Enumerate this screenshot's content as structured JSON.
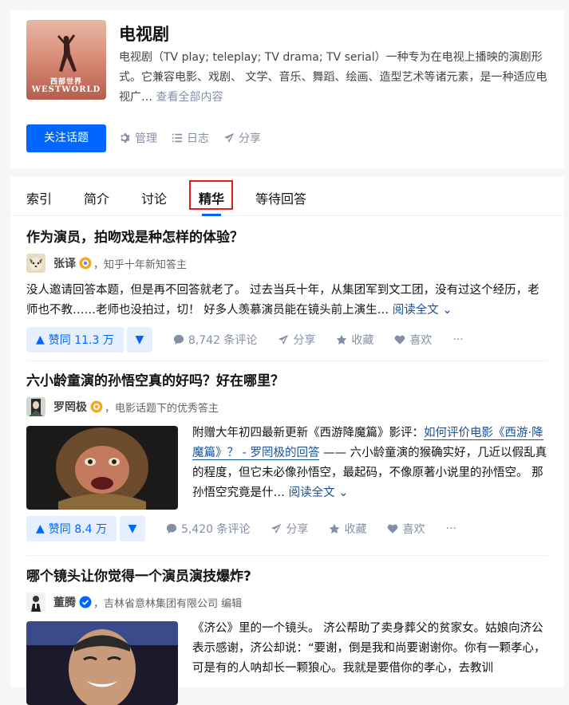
{
  "topic": {
    "cover_cn": "西部世界",
    "cover_en": "WESTWORLD",
    "title": "电视剧",
    "description": "电视剧（TV play; teleplay; TV drama; TV serial）一种专为在电视上播映的演剧形式。它兼容电影、戏剧、 文学、音乐、舞蹈、绘画、造型艺术等诸元素，是一种适应电视广…",
    "view_all": "查看全部内容",
    "follow_label": "关注话题",
    "actions": [
      {
        "icon": "gear-icon",
        "label": "管理"
      },
      {
        "icon": "list-icon",
        "label": "日志"
      },
      {
        "icon": "share-icon",
        "label": "分享"
      }
    ]
  },
  "tabs": [
    "索引",
    "简介",
    "讨论",
    "精华",
    "等待回答"
  ],
  "active_tab": "精华",
  "colors": {
    "accent": "#0066ff",
    "highlight_box": "#e0201e",
    "link": "#175199"
  },
  "items": [
    {
      "title": "作为演员，拍吻戏是种怎样的体验？",
      "author": "张译",
      "badge": "gold-badge-icon",
      "bio": "，知乎十年新知答主",
      "excerpt": "没人邀请回答本题，但是再不回答就老了。 过去当兵十年，从集团军到文工团，没有过这个经历，老师也不教……老师也没拍过，切！ 好多人羡慕演员能在镜头前上演生…",
      "read_more": "阅读全文",
      "votes": "赞同 11.3 万",
      "comments": "8,742 条评论",
      "share": "分享",
      "collect": "收藏",
      "like": "喜欢",
      "more": "···"
    },
    {
      "title": "六小龄童演的孙悟空真的好吗？好在哪里？",
      "author": "罗罔极",
      "badge": "gold-badge-icon",
      "bio": "，电影话题下的优秀答主",
      "excerpt_pre": "附赠大年初四最新更新《西游降魔篇》影评：",
      "excerpt_link": "如何评价电影《西游·降魔篇》？ - 罗罔极的回答",
      "excerpt_post": " —— 六小龄童演的猴确实好，几近以假乱真的程度，但它未必像孙悟空，最起码，不像原著小说里的孙悟空。 那孙悟空究竟是什…",
      "read_more": "阅读全文",
      "votes": "赞同 8.4 万",
      "comments": "5,420 条评论",
      "share": "分享",
      "collect": "收藏",
      "like": "喜欢",
      "more": "···"
    },
    {
      "title": "哪个镜头让你觉得一个演员演技爆炸?",
      "author": "董腾",
      "badge": "blue-verified-icon",
      "bio": "，吉林省意林集团有限公司 编辑",
      "excerpt": "《济公》里的一个镜头。 济公帮助了卖身葬父的贫家女。姑娘向济公表示感谢，济公却说：“要谢，倒是我和尚要谢谢你。你有一颗孝心，可是有的人呐却长一颗狼心。我就是要借你的孝心，去教训"
    }
  ]
}
